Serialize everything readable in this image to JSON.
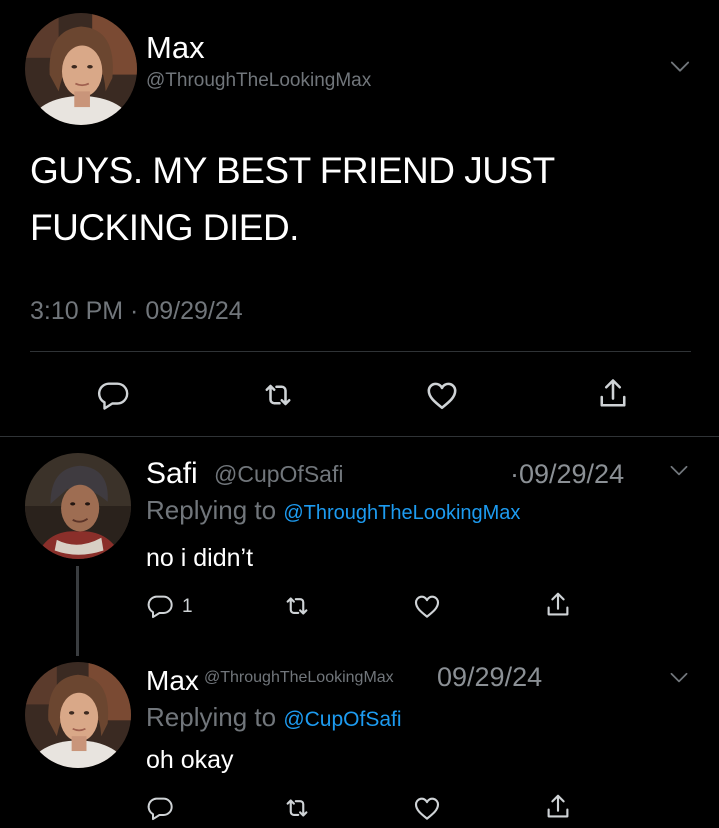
{
  "main_tweet": {
    "author_name": "Max",
    "handle": "@ThroughTheLookingMax",
    "text_line1": "GUYS. MY BEST FRIEND JUST",
    "text_line2": "FUCKING DIED.",
    "timestamp": "3:10 PM · 09/29/24"
  },
  "reply1": {
    "author_name": "Safi",
    "handle": "@CupOfSafi",
    "date": "·09/29/24",
    "replying_prefix": "Replying to",
    "replying_to": "@ThroughTheLookingMax",
    "text": "no i didn’t",
    "reply_count": "1"
  },
  "reply2": {
    "author_name": "Max",
    "handle": "@ThroughTheLookingMax",
    "date": "09/29/24",
    "replying_prefix": "Replying to",
    "replying_to": "@CupOfSafi",
    "text": "oh okay"
  },
  "icons": {
    "reply": "reply-icon",
    "retweet": "retweet-icon",
    "like": "heart-icon",
    "share": "share-icon",
    "more": "chevron-down-icon"
  },
  "colors": {
    "background": "#000000",
    "text": "#ffffff",
    "muted": "#71767b",
    "link": "#1d9bf0",
    "divider": "#2f3336"
  }
}
